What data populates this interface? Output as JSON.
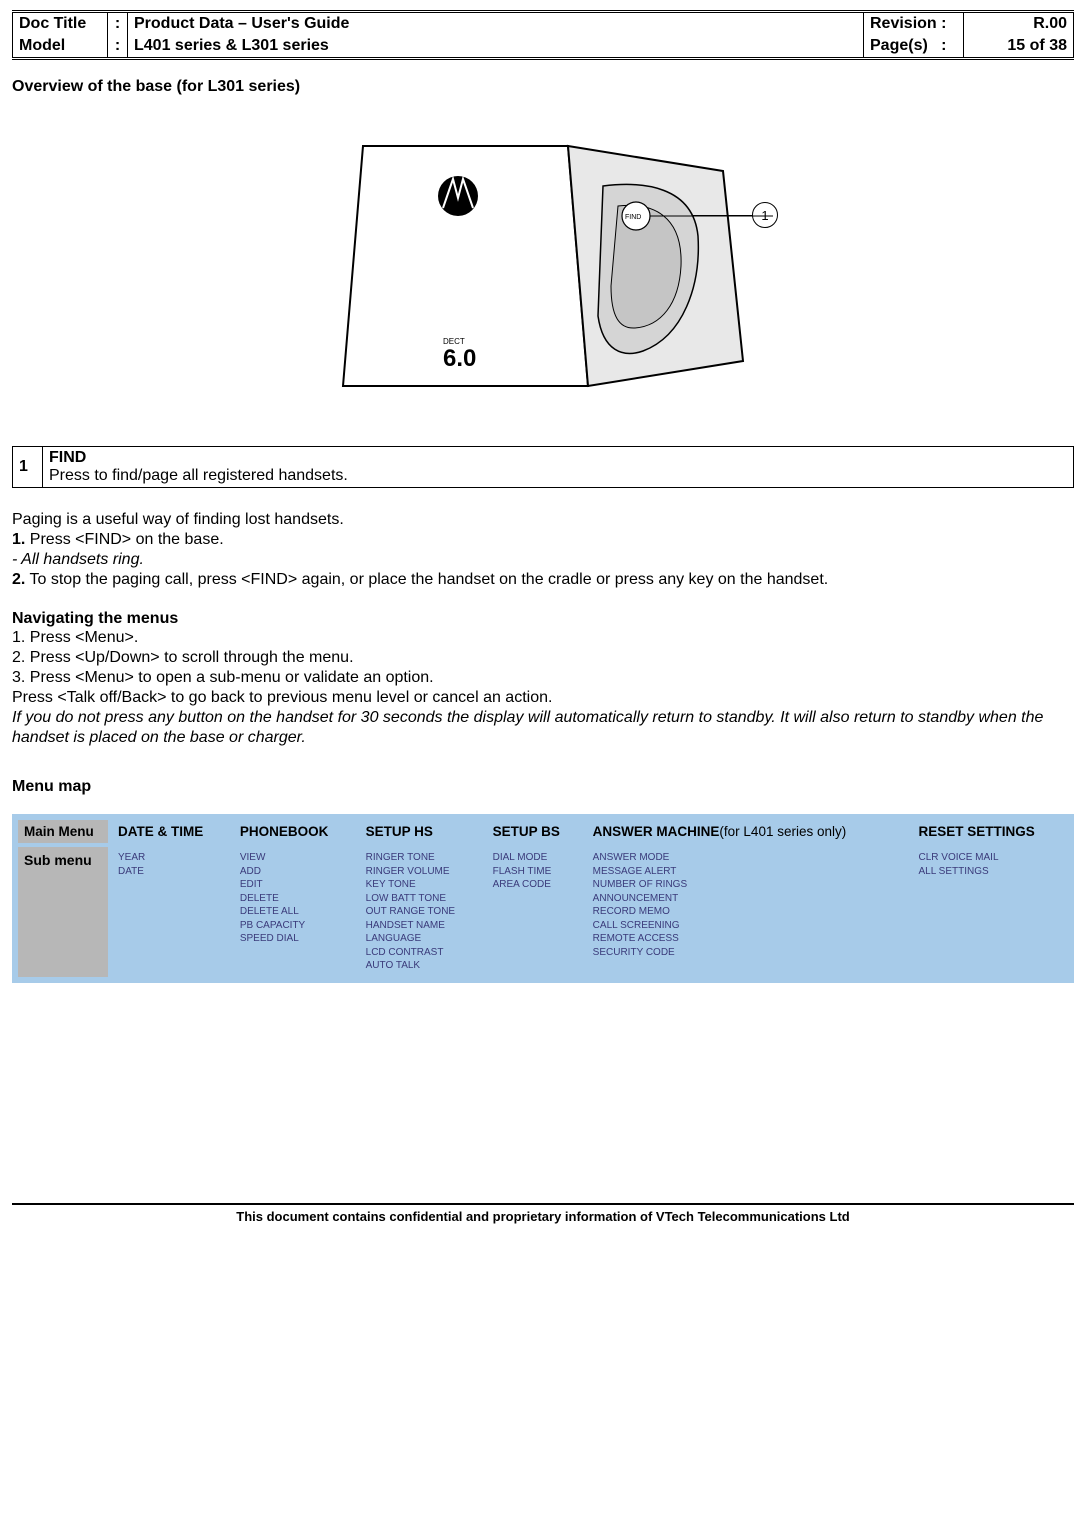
{
  "header": {
    "doc_title_label": "Doc Title",
    "doc_title_value": "Product Data – User's Guide",
    "model_label": "Model",
    "model_value": "L401 series & L301 series",
    "revision_label": "Revision",
    "revision_value": "R.00",
    "pages_label": "Page(s)",
    "pages_value": "15 of 38",
    "colon": ":"
  },
  "overview_title": "Overview of the base (for L301 series)",
  "device": {
    "find_label": "FIND",
    "dect_small": "DECT",
    "dect_big": "6.0",
    "callout_num": "1"
  },
  "find_box": {
    "num": "1",
    "title": "FIND",
    "desc": "Press to find/page all registered handsets."
  },
  "paging": {
    "intro": "Paging is a useful way of finding lost handsets.",
    "step1_num": "1.",
    "step1_text": " Press <FIND> on the base.",
    "all_ring": "- All handsets ring.",
    "step2_num": "2.",
    "step2_text": " To stop the paging call, press <FIND> again, or place the handset on the cradle or press any key on the handset."
  },
  "nav": {
    "heading": "Navigating the menus",
    "line1": "1. Press <Menu>.",
    "line2": "2. Press <Up/Down> to scroll through the menu.",
    "line3": "3. Press <Menu> to open a sub-menu or validate an option.",
    "line4": "Press <Talk off/Back> to go back to previous menu level or cancel an action.",
    "note": "If you do not press any button on the handset for 30 seconds the display will automatically return to standby. It will also return to standby when the handset is placed on the base or charger."
  },
  "menu_map_heading": "Menu map",
  "menu": {
    "main_label": "Main Menu",
    "sub_label": "Sub menu",
    "cols": {
      "c1": "DATE & TIME",
      "c2": "PHONEBOOK",
      "c3": "SETUP HS",
      "c4": "SETUP BS",
      "c5_bold": "ANSWER MACHINE",
      "c5_rest": "(for L401 series only)",
      "c6": "RESET SETTINGS"
    },
    "sub": {
      "c1": "YEAR\nDATE",
      "c2": "VIEW\nADD\nEDIT\nDELETE\nDELETE ALL\nPB CAPACITY\nSPEED DIAL",
      "c3": "RINGER TONE\nRINGER VOLUME\nKEY TONE\nLOW BATT TONE\nOUT RANGE TONE\nHANDSET NAME\nLANGUAGE\nLCD CONTRAST\nAUTO TALK",
      "c4": "DIAL MODE\nFLASH TIME\nAREA CODE",
      "c5": "ANSWER MODE\nMESSAGE ALERT\nNUMBER OF RINGS\nANNOUNCEMENT\nRECORD MEMO\nCALL SCREENING\nREMOTE ACCESS\nSECURITY CODE",
      "c6": "CLR VOICE MAIL\nALL SETTINGS"
    }
  },
  "footer": "This document contains confidential and proprietary information of VTech Telecommunications Ltd"
}
